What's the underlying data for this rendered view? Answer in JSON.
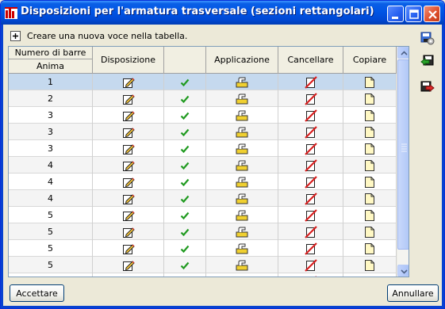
{
  "window": {
    "title": "Disposizioni per l'armatura trasversale (sezioni rettangolari)"
  },
  "toolbar": {
    "add_label": "Creare una nuova voce nella tabella."
  },
  "table": {
    "headers": {
      "numero_top": "Numero di barre",
      "numero_bottom": "Anima",
      "disposizione": "Disposizione",
      "check": "",
      "applicazione": "Applicazione",
      "cancellare": "Cancellare",
      "copiare": "Copiare"
    },
    "rows": [
      {
        "anima": "1",
        "selected": true
      },
      {
        "anima": "2"
      },
      {
        "anima": "3"
      },
      {
        "anima": "3"
      },
      {
        "anima": "3"
      },
      {
        "anima": "4"
      },
      {
        "anima": "4"
      },
      {
        "anima": "4"
      },
      {
        "anima": "5"
      },
      {
        "anima": "5"
      },
      {
        "anima": "5"
      },
      {
        "anima": "5"
      },
      {
        "anima": "5"
      }
    ]
  },
  "buttons": {
    "accept": "Accettare",
    "cancel": "Annullare"
  },
  "icons": {
    "edit": "pencil-edit-icon",
    "check": "green-checkmark-icon",
    "apply": "apply-hand-icon",
    "delete": "delete-red-slash-icon",
    "copy": "copy-page-icon",
    "side_1": "config-disk-icon",
    "side_2": "import-disk-icon",
    "side_3": "export-disk-icon"
  },
  "colors": {
    "titlebar": "#0055e5",
    "selected_row": "#c5d9ee",
    "check_green": "#1f9a1f",
    "delete_red": "#d81e1e"
  }
}
